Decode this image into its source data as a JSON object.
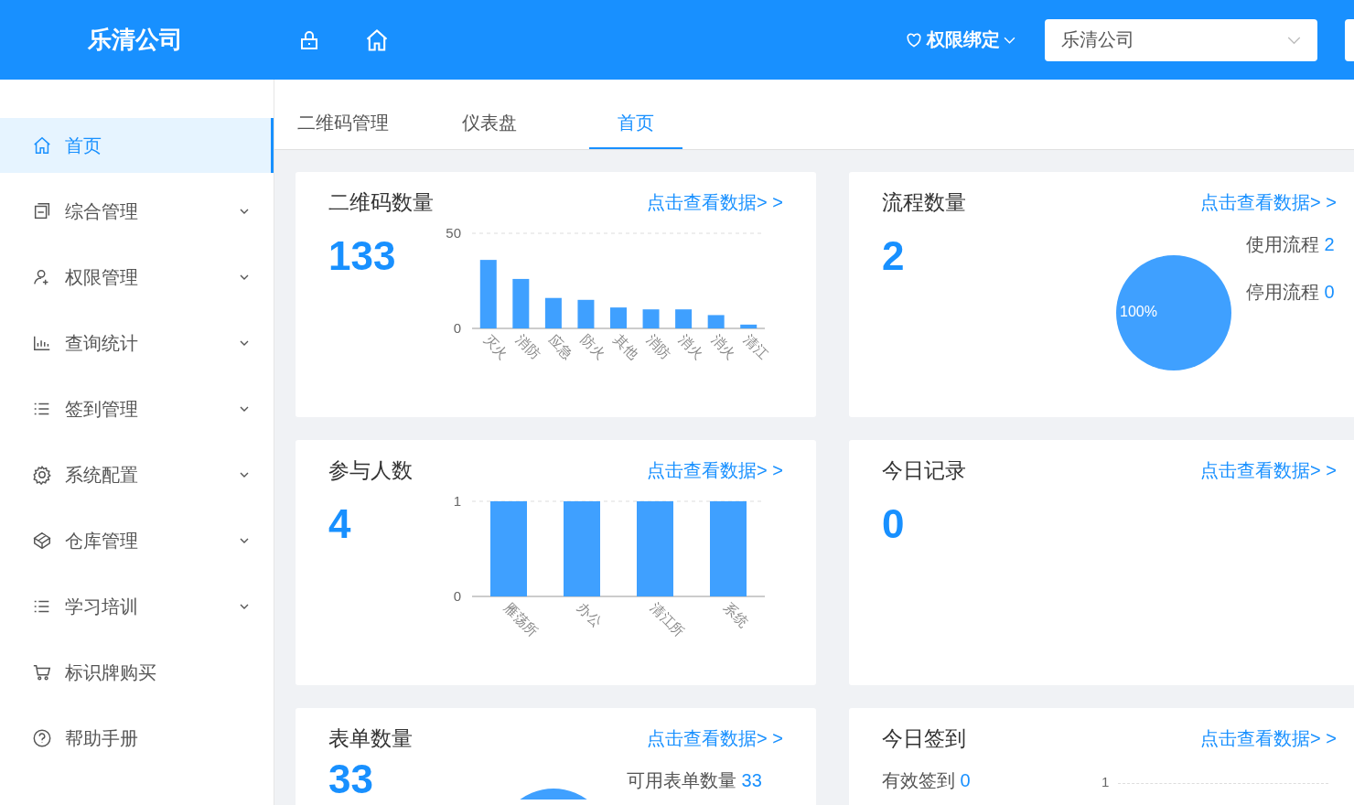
{
  "header": {
    "logo": "乐清公司",
    "binding_menu": "权限绑定",
    "company_select": {
      "value": "乐清公司"
    }
  },
  "sidebar": {
    "items": [
      {
        "label": "首页",
        "kind": "home",
        "selected": true,
        "expandable": false
      },
      {
        "label": "综合管理",
        "kind": "doc",
        "selected": false,
        "expandable": true
      },
      {
        "label": "权限管理",
        "kind": "user",
        "selected": false,
        "expandable": true
      },
      {
        "label": "查询统计",
        "kind": "chart",
        "selected": false,
        "expandable": true
      },
      {
        "label": "签到管理",
        "kind": "list",
        "selected": false,
        "expandable": true
      },
      {
        "label": "系统配置",
        "kind": "gear",
        "selected": false,
        "expandable": true
      },
      {
        "label": "仓库管理",
        "kind": "box",
        "selected": false,
        "expandable": true
      },
      {
        "label": "学习培训",
        "kind": "list",
        "selected": false,
        "expandable": true
      },
      {
        "label": "标识牌购买",
        "kind": "cart",
        "selected": false,
        "expandable": false
      },
      {
        "label": "帮助手册",
        "kind": "help",
        "selected": false,
        "expandable": false
      }
    ]
  },
  "tabs": [
    {
      "label": "二维码管理",
      "selected": false
    },
    {
      "label": "仪表盘",
      "selected": false
    },
    {
      "label": "首页",
      "selected": true
    }
  ],
  "cards": [
    {
      "kind": "bar",
      "title": "二维码数量",
      "link": "点击查看数据> >",
      "total": "133",
      "chart_data": {
        "type": "bar",
        "categories": [
          "灭火",
          "消防",
          "应急",
          "防火",
          "其他",
          "消防",
          "消火",
          "消火",
          "清江"
        ],
        "values": [
          36,
          26,
          16,
          15,
          11,
          10,
          10,
          7,
          2
        ],
        "yticks": [
          0,
          50
        ],
        "ylim": [
          0,
          50
        ]
      }
    },
    {
      "kind": "pie",
      "title": "流程数量",
      "link": "点击查看数据> >",
      "total": "2",
      "legend": [
        {
          "value": "2"
        },
        {
          "value": "0"
        }
      ],
      "chart_data": {
        "type": "pie",
        "categories": [
          "使用流程",
          "停用流程"
        ],
        "values": [
          100,
          0
        ],
        "value_labels": [
          "100%",
          null
        ]
      }
    },
    {
      "kind": "bar",
      "title": "参与人数",
      "link": "点击查看数据> >",
      "total": "4",
      "chart_data": {
        "type": "bar",
        "categories": [
          "雁荡所",
          "办公",
          "清江所",
          "系统"
        ],
        "values": [
          1,
          1,
          1,
          1
        ],
        "yticks": [
          0,
          1
        ],
        "ylim": [
          0,
          1
        ]
      }
    },
    {
      "kind": "plain",
      "title": "今日记录",
      "link": "点击查看数据> >",
      "total": "0"
    },
    {
      "kind": "partial_pie",
      "title": "表单数量",
      "link": "点击查看数据> >",
      "total": "33",
      "legend": [
        {
          "label": "可用表单数量",
          "value": "33"
        }
      ]
    },
    {
      "kind": "signin",
      "title": "今日签到",
      "link": "点击查看数据> >",
      "legend": [
        {
          "label": "有效签到",
          "value": "0"
        }
      ],
      "tick": "1"
    }
  ]
}
